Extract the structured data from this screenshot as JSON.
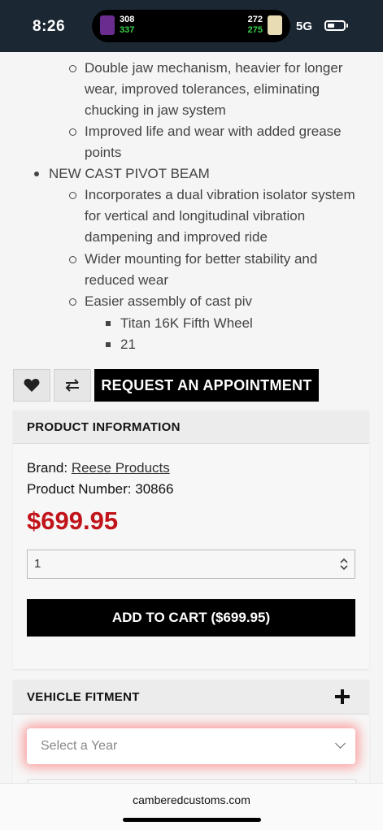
{
  "status": {
    "time": "8:26",
    "network": "5G",
    "score_left_top": "308",
    "score_left_bottom": "337",
    "score_right_top": "272",
    "score_right_bottom": "275"
  },
  "description": {
    "sub1_lines": [
      "Double jaw mechanism, heavier for longer",
      "wear, improved tolerances, eliminating",
      "chucking in jaw system"
    ],
    "sub2_lines": [
      "Improved life and wear with added grease",
      "points"
    ],
    "main_item": "NEW CAST PIVOT BEAM",
    "sub3_lines": [
      "Incorporates a dual vibration isolator system",
      "for vertical and longitudinal vibration",
      "dampening and improved ride"
    ],
    "sub4_lines": [
      "Wider mounting for better stability and",
      "reduced wear"
    ],
    "sub5": "Easier assembly of cast piv",
    "square1": "Titan 16K Fifth Wheel",
    "square2": "21"
  },
  "actions": {
    "appointment_label": "REQUEST AN APPOINTMENT"
  },
  "product": {
    "section_title": "PRODUCT INFORMATION",
    "brand_label": "Brand:",
    "brand_value": "Reese Products",
    "number_label": "Product Number:",
    "number_value": "30866",
    "price": "$699.95",
    "quantity": "1",
    "add_to_cart": "ADD TO CART ($699.95)"
  },
  "fitment": {
    "section_title": "VEHICLE FITMENT",
    "year_placeholder": "Select a Year"
  },
  "browser": {
    "url": "camberedcustoms.com"
  }
}
